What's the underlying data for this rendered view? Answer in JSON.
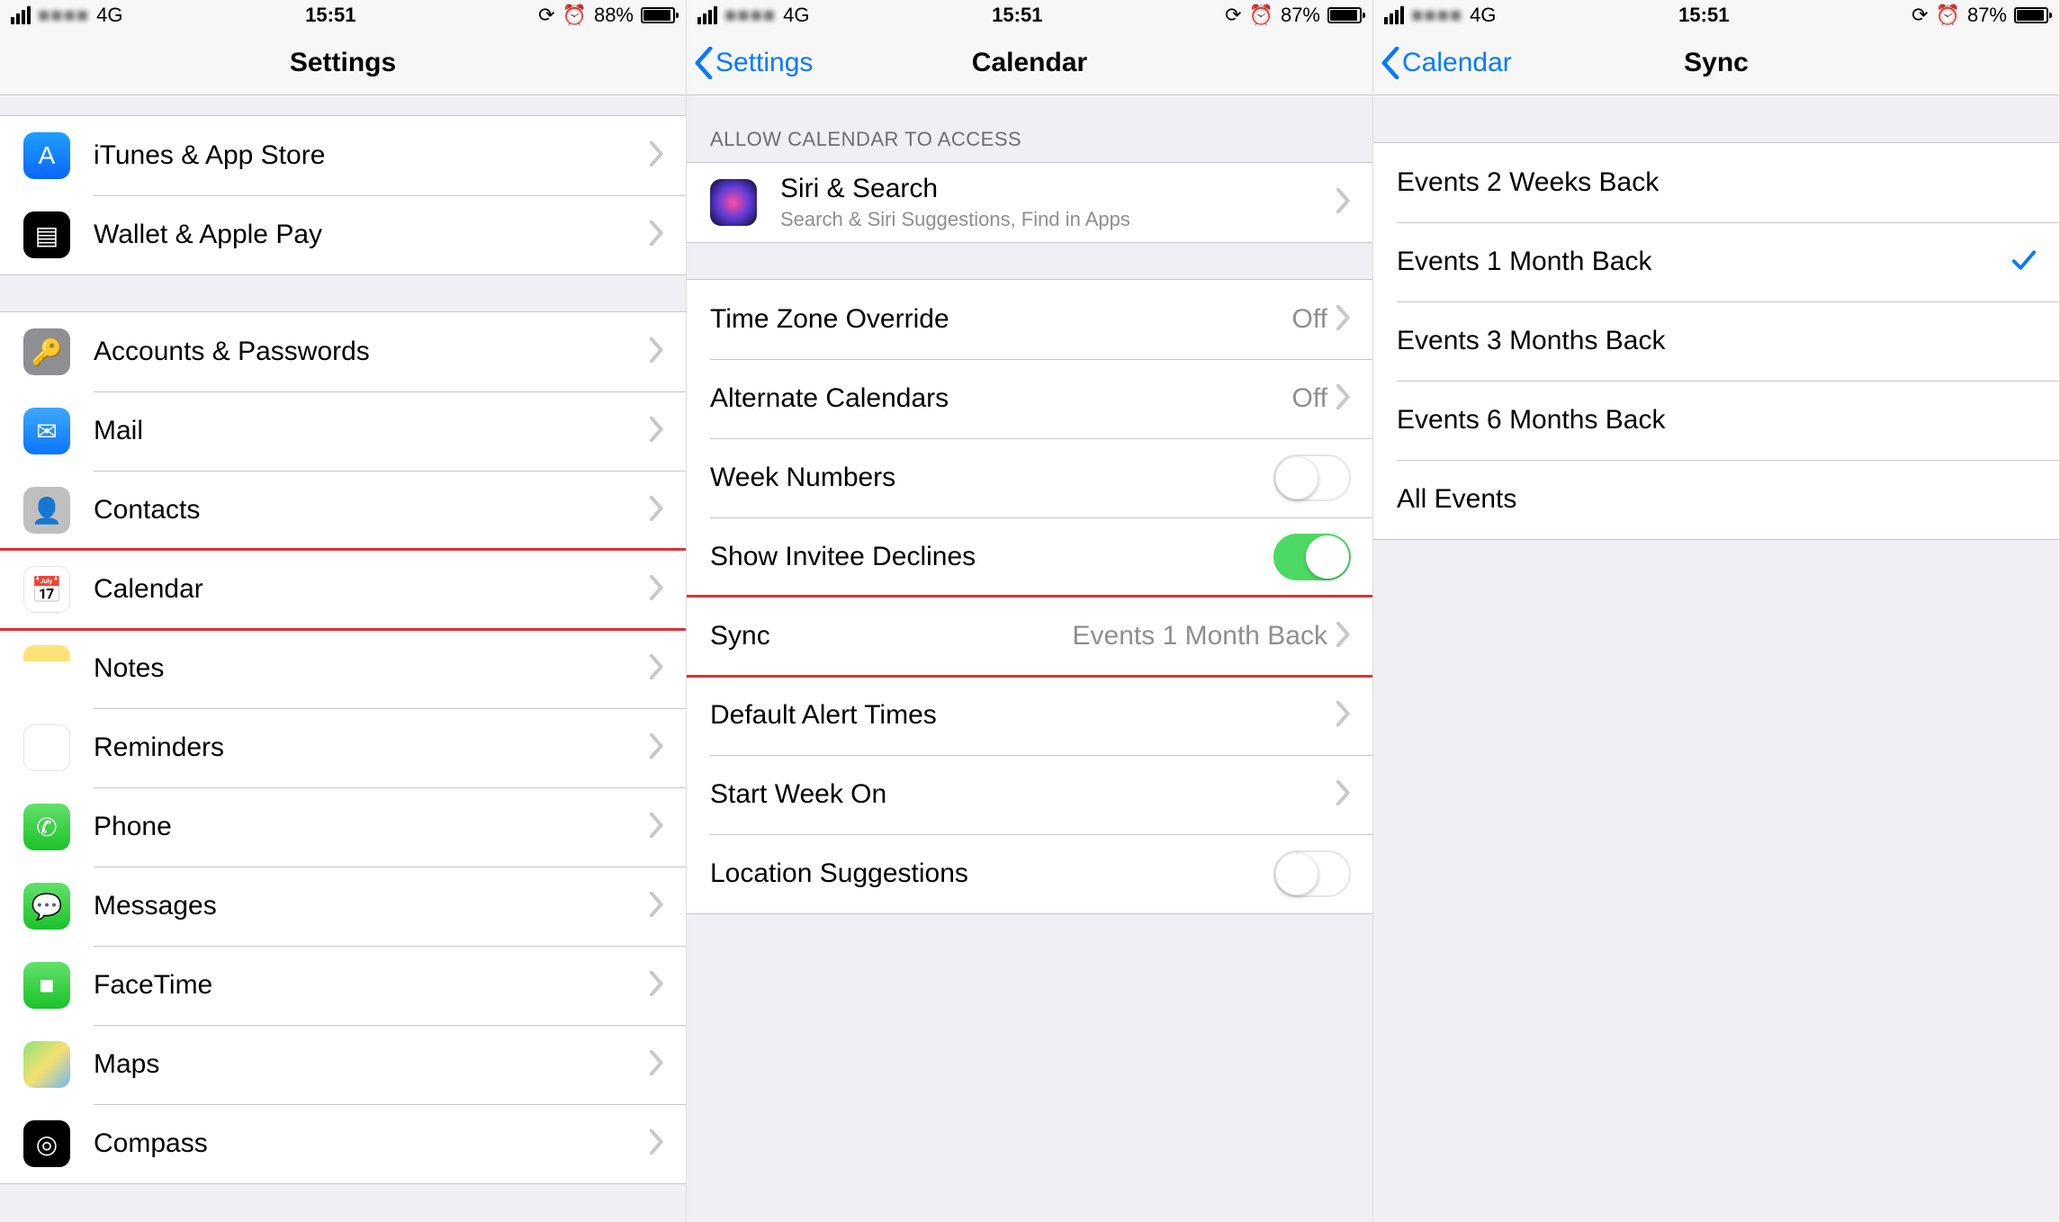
{
  "screens": [
    {
      "status": {
        "network": "4G",
        "time": "15:51",
        "battery_pct": "88%",
        "battery_fill": 88
      },
      "nav": {
        "title": "Settings",
        "back": null
      },
      "groups": [
        {
          "rows": [
            {
              "id": "itunes",
              "icon": "ic-appstore",
              "iconGlyph": "A",
              "label": "iTunes & App Store"
            },
            {
              "id": "wallet",
              "icon": "ic-wallet",
              "iconGlyph": "▤",
              "label": "Wallet & Apple Pay"
            }
          ]
        },
        {
          "rows": [
            {
              "id": "accounts",
              "icon": "ic-accounts",
              "iconGlyph": "🔑",
              "label": "Accounts & Passwords"
            },
            {
              "id": "mail",
              "icon": "ic-mail",
              "iconGlyph": "✉",
              "label": "Mail"
            },
            {
              "id": "contacts",
              "icon": "ic-contacts",
              "iconGlyph": "👤",
              "label": "Contacts"
            },
            {
              "id": "calendar",
              "icon": "ic-calendar",
              "iconGlyph": "📅",
              "label": "Calendar",
              "highlight": true
            },
            {
              "id": "notes",
              "icon": "ic-notes",
              "iconGlyph": "",
              "label": "Notes"
            },
            {
              "id": "reminders",
              "icon": "ic-reminders",
              "iconGlyph": "☰",
              "label": "Reminders"
            },
            {
              "id": "phone",
              "icon": "ic-phone",
              "iconGlyph": "✆",
              "label": "Phone"
            },
            {
              "id": "messages",
              "icon": "ic-messages",
              "iconGlyph": "💬",
              "label": "Messages"
            },
            {
              "id": "facetime",
              "icon": "ic-facetime",
              "iconGlyph": "■",
              "label": "FaceTime"
            },
            {
              "id": "maps",
              "icon": "ic-maps",
              "iconGlyph": "",
              "label": "Maps"
            },
            {
              "id": "compass",
              "icon": "ic-compass",
              "iconGlyph": "◎",
              "label": "Compass"
            }
          ]
        }
      ]
    },
    {
      "status": {
        "network": "4G",
        "time": "15:51",
        "battery_pct": "87%",
        "battery_fill": 87
      },
      "nav": {
        "title": "Calendar",
        "back": "Settings"
      },
      "section_header": "ALLOW CALENDAR TO ACCESS",
      "siri": {
        "label": "Siri & Search",
        "sub": "Search & Siri Suggestions, Find in Apps"
      },
      "rows": [
        {
          "id": "tzo",
          "label": "Time Zone Override",
          "value": "Off",
          "chevron": true
        },
        {
          "id": "altcal",
          "label": "Alternate Calendars",
          "value": "Off",
          "chevron": true
        },
        {
          "id": "weeknum",
          "label": "Week Numbers",
          "toggle": "off"
        },
        {
          "id": "invitee",
          "label": "Show Invitee Declines",
          "toggle": "on"
        },
        {
          "id": "sync",
          "label": "Sync",
          "value": "Events 1 Month Back",
          "chevron": true,
          "highlight": true
        },
        {
          "id": "alerts",
          "label": "Default Alert Times",
          "chevron": true
        },
        {
          "id": "startwk",
          "label": "Start Week On",
          "chevron": true
        },
        {
          "id": "locsug",
          "label": "Location Suggestions",
          "toggle": "off"
        }
      ]
    },
    {
      "status": {
        "network": "4G",
        "time": "15:51",
        "battery_pct": "87%",
        "battery_fill": 87
      },
      "nav": {
        "title": "Sync",
        "back": "Calendar"
      },
      "options": [
        {
          "id": "2w",
          "label": "Events 2 Weeks Back",
          "selected": false
        },
        {
          "id": "1m",
          "label": "Events 1 Month Back",
          "selected": true
        },
        {
          "id": "3m",
          "label": "Events 3 Months Back",
          "selected": false
        },
        {
          "id": "6m",
          "label": "Events 6 Months Back",
          "selected": false
        },
        {
          "id": "all",
          "label": "All Events",
          "selected": false
        }
      ]
    }
  ]
}
